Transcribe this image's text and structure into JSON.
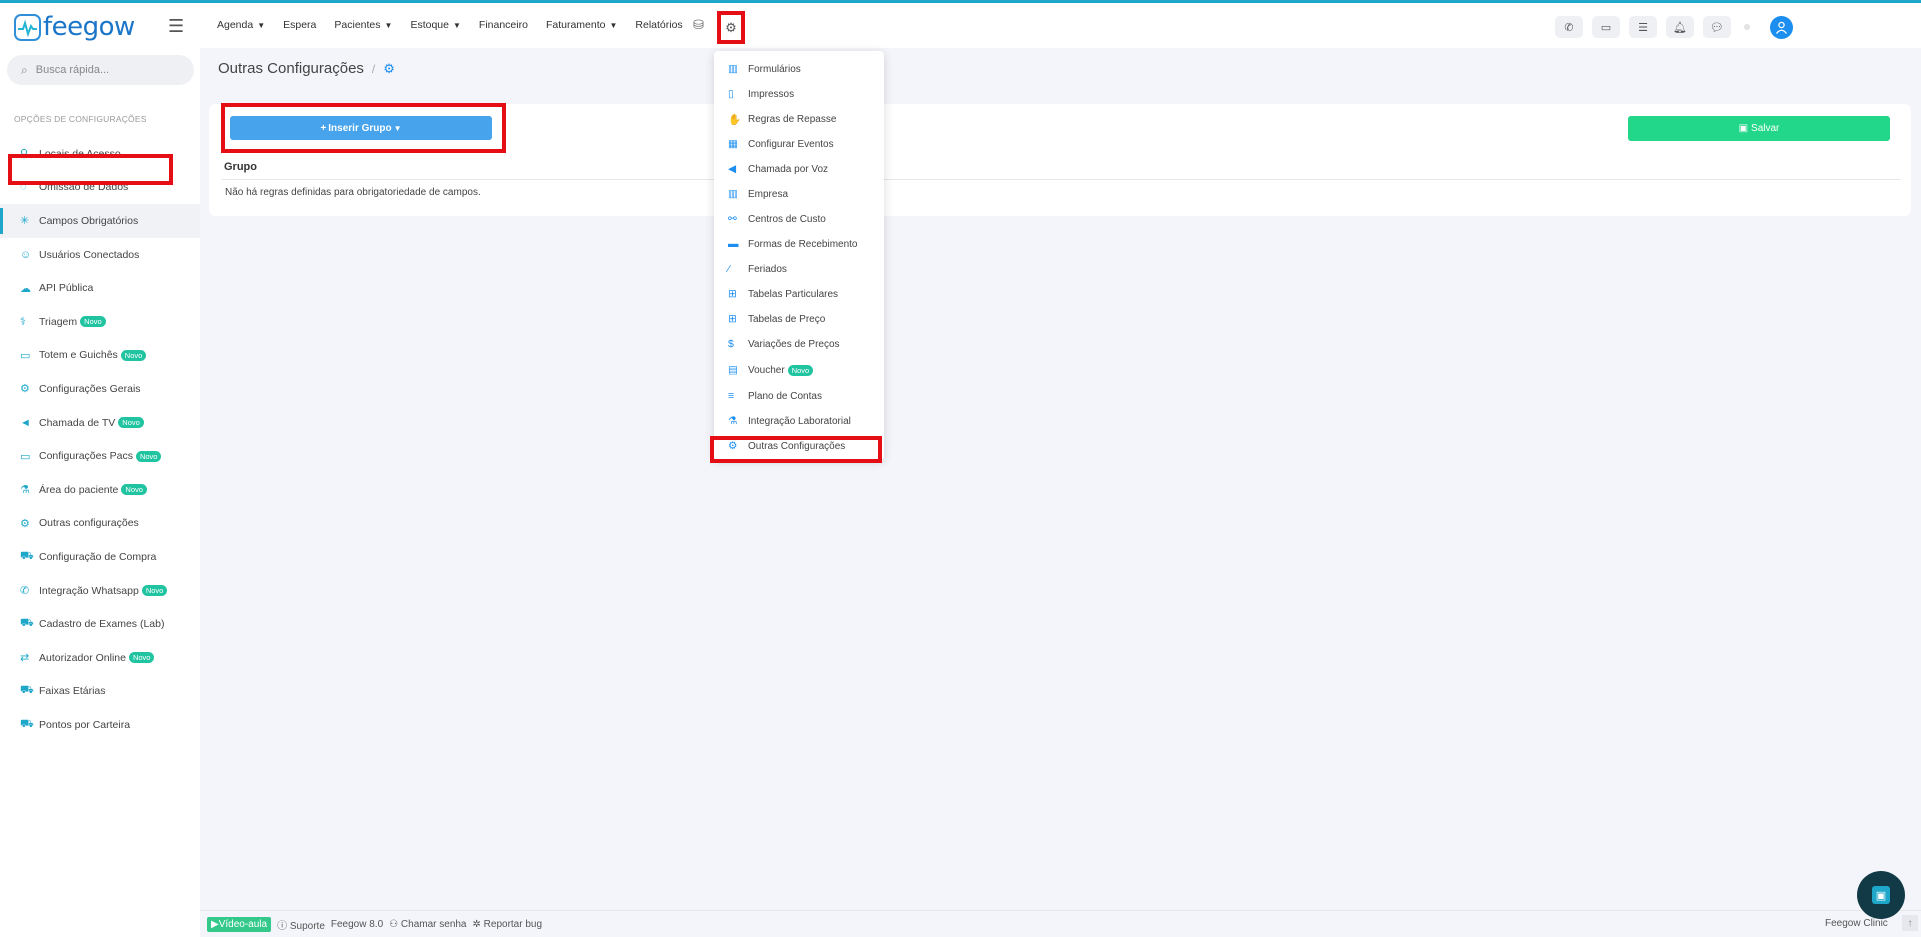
{
  "brand": {
    "logo_text": "feegow"
  },
  "nav": {
    "items": [
      {
        "label": "Agenda",
        "caret": true
      },
      {
        "label": "Espera",
        "caret": false
      },
      {
        "label": "Pacientes",
        "caret": true
      },
      {
        "label": "Estoque",
        "caret": true
      },
      {
        "label": "Financeiro",
        "caret": false
      },
      {
        "label": "Faturamento",
        "caret": true
      },
      {
        "label": "Relatórios",
        "caret": false
      }
    ]
  },
  "search": {
    "placeholder": "Busca rápida..."
  },
  "sidebar": {
    "title": "OPÇÕES DE CONFIGURAÇÕES",
    "items": [
      {
        "label": "Locais de Acesso",
        "icon": "location-icon",
        "badge": ""
      },
      {
        "label": "Omissão de Dados",
        "icon": "eye-off-icon",
        "badge": ""
      },
      {
        "label": "Campos Obrigatórios",
        "icon": "asterisk-icon",
        "badge": ""
      },
      {
        "label": "Usuários Conectados",
        "icon": "user-icon",
        "badge": ""
      },
      {
        "label": "API Pública",
        "icon": "cloud-icon",
        "badge": ""
      },
      {
        "label": "Triagem",
        "icon": "stethoscope-icon",
        "badge": "Novo"
      },
      {
        "label": "Totem e Guichês",
        "icon": "laptop-icon",
        "badge": "Novo"
      },
      {
        "label": "Configurações Gerais",
        "icon": "gears-icon",
        "badge": ""
      },
      {
        "label": "Chamada de TV",
        "icon": "megaphone-icon",
        "badge": "Novo"
      },
      {
        "label": "Configurações Pacs",
        "icon": "laptop-icon",
        "badge": "Novo"
      },
      {
        "label": "Área do paciente",
        "icon": "flask-icon",
        "badge": "Novo"
      },
      {
        "label": "Outras configurações",
        "icon": "gears-icon",
        "badge": ""
      },
      {
        "label": "Configuração de Compra",
        "icon": "cart-icon",
        "badge": ""
      },
      {
        "label": "Integração Whatsapp",
        "icon": "whatsapp-icon",
        "badge": "Novo"
      },
      {
        "label": "Cadastro de Exames (Lab)",
        "icon": "cart-icon",
        "badge": ""
      },
      {
        "label": "Autorizador Online",
        "icon": "exchange-icon",
        "badge": "Novo"
      },
      {
        "label": "Faixas Etárias",
        "icon": "cart-icon",
        "badge": ""
      },
      {
        "label": "Pontos por Carteira",
        "icon": "cart-icon",
        "badge": ""
      }
    ]
  },
  "breadcrumb": {
    "title": "Outras Configurações",
    "separator": "/"
  },
  "main": {
    "insert_button": "Inserir Grupo",
    "save_button": "Salvar",
    "column_header": "Grupo",
    "empty_message": "Não há regras definidas para obrigatoriedade de campos."
  },
  "dropdown": {
    "items": [
      {
        "label": "Formulários",
        "icon": "chart-icon",
        "badge": ""
      },
      {
        "label": "Impressos",
        "icon": "file-icon",
        "badge": ""
      },
      {
        "label": "Regras de Repasse",
        "icon": "hand-money-icon",
        "badge": ""
      },
      {
        "label": "Configurar Eventos",
        "icon": "calendar-icon",
        "badge": ""
      },
      {
        "label": "Chamada por Voz",
        "icon": "volume-icon",
        "badge": ""
      },
      {
        "label": "Empresa",
        "icon": "building-icon",
        "badge": ""
      },
      {
        "label": "Centros de Custo",
        "icon": "sitemap-icon",
        "badge": ""
      },
      {
        "label": "Formas de Recebimento",
        "icon": "credit-card-icon",
        "badge": ""
      },
      {
        "label": "Feriados",
        "icon": "road-icon",
        "badge": ""
      },
      {
        "label": "Tabelas Particulares",
        "icon": "table-icon",
        "badge": ""
      },
      {
        "label": "Tabelas de Preço",
        "icon": "table-icon",
        "badge": ""
      },
      {
        "label": "Variações de Preços",
        "icon": "dollar-icon",
        "badge": ""
      },
      {
        "label": "Voucher",
        "icon": "ticket-icon",
        "badge": "Novo"
      },
      {
        "label": "Plano de Contas",
        "icon": "list-indent-icon",
        "badge": ""
      },
      {
        "label": "Integração Laboratorial",
        "icon": "flask-icon",
        "badge": ""
      },
      {
        "label": "Outras Configurações",
        "icon": "gears-icon",
        "badge": ""
      }
    ]
  },
  "footer": {
    "video": "Vídeo-aula",
    "support": "Suporte",
    "version": "Feegow 8.0",
    "call": "Chamar senha",
    "bug": "Reportar bug",
    "brand_right": "Feegow Clinic"
  },
  "colors": {
    "accent": "#1ea7c9",
    "primary_button": "#46a3ec",
    "save_button": "#22d78a",
    "badge": "#21c4a0",
    "highlight": "#e40e14"
  }
}
